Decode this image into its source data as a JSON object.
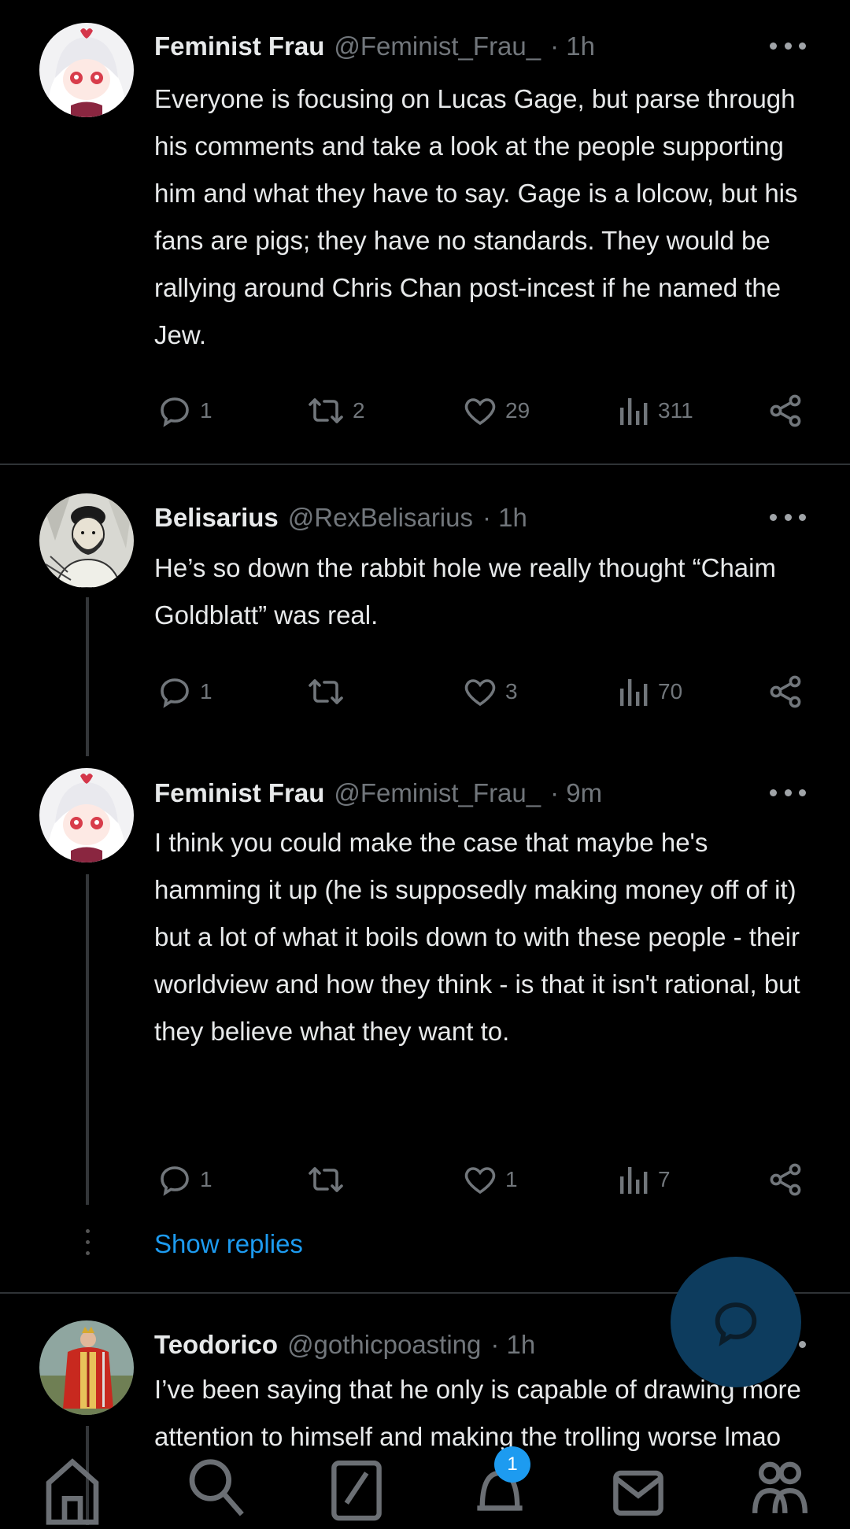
{
  "tweets": [
    {
      "name": "Feminist Frau",
      "handle": "@Feminist_Frau_",
      "time": "· 1h",
      "text": "Everyone is focusing on Lucas Gage, but parse through his comments and take a look at the people supporting him and what they have to say. Gage is a lolcow, but his fans are pigs; they have no standards. They would be rallying around Chris Chan post-incest if he named the Jew.",
      "replies": "1",
      "reposts": "2",
      "likes": "29",
      "views": "311"
    },
    {
      "name": "Belisarius",
      "handle": "@RexBelisarius",
      "time": "· 1h",
      "text": "He’s so down the rabbit hole we really thought “Chaim Goldblatt” was real.",
      "replies": "1",
      "reposts": "",
      "likes": "3",
      "views": "70"
    },
    {
      "name": "Feminist Frau",
      "handle": "@Feminist_Frau_",
      "time": "· 9m",
      "text": "I think you could make the case that maybe he's hamming it up (he is supposedly making money off of it) but a lot of what it boils down to with these people - their worldview and how they think - is that it isn't rational, but they believe what they want to.",
      "replies": "1",
      "reposts": "",
      "likes": "1",
      "views": "7"
    },
    {
      "name": "Teodorico",
      "handle": "@gothicpoasting",
      "time": "· 1h",
      "text": "I’ve been saying that he only is capable of drawing more attention to himself and making the trolling worse lmao"
    }
  ],
  "show_replies": "Show replies",
  "notifications_badge": "1",
  "icons": {
    "reply": "speech-bubble-icon",
    "repost": "repost-arrows-icon",
    "like": "heart-icon",
    "views": "bar-chart-icon",
    "share": "share-nodes-icon",
    "more": "more-horizontal-icon",
    "compose": "compose-reply-icon"
  },
  "colors": {
    "background": "#000000",
    "text": "#e7e9ea",
    "muted": "#71767b",
    "accent": "#1d9bf0",
    "fab": "#0d3c5e"
  }
}
